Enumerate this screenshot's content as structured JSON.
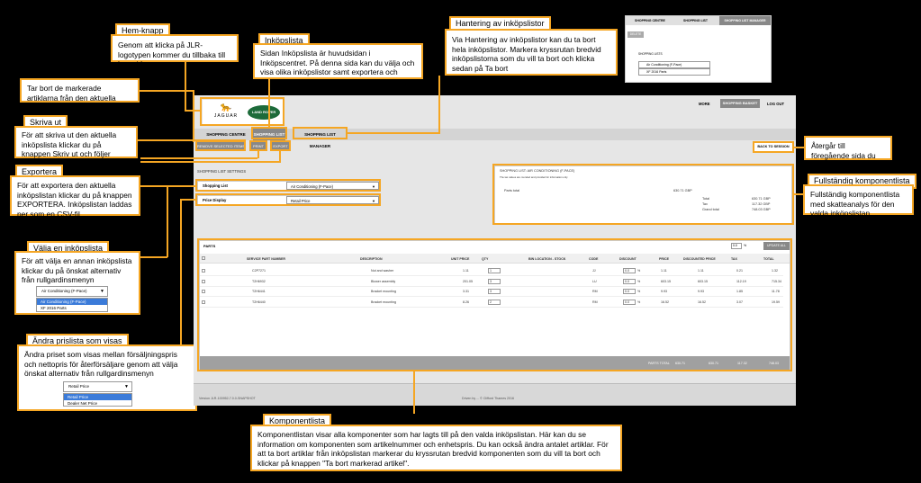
{
  "callouts": {
    "hem": {
      "title": "Hem-knapp",
      "text": "Genom att klicka på JLR-logotypen kommer du tillbaka till hemsidan"
    },
    "inkop": {
      "title": "Inköpslista",
      "text": "Sidan Inköpslista är huvudsidan i Inköpscentret. På denna sida kan du välja och visa olika inköpslistor samt exportera och skriva ut"
    },
    "hantering": {
      "title": "Hantering av inköpslistor",
      "text": "Via Hantering av inköpslistor kan du ta bort hela inköpslistor. Markera kryssrutan bredvid inköpslistorna som du vill ta bort och klicka sedan på Ta bort"
    },
    "tarbort": {
      "text": "Tar bort de markerade artiklarna från den aktuella inköpslistan"
    },
    "skriv": {
      "title": "Skriva ut",
      "text": "För att skriva ut den aktuella inköpslista klickar du på knappen Skriv ut och följer utskriftsguiden"
    },
    "export": {
      "title": "Exportera",
      "text": "För att exportera den aktuella inköpslistan klickar du på knappen EXPORTERA. Inköpslistan laddas ner som en CSV-fil"
    },
    "valja": {
      "title": "Välja en inköpslista",
      "text": "För att välja en annan inköpslista klickar du på önskat alternativ från rullgardinsmenyn"
    },
    "andra": {
      "title": "Ändra prislista som visas",
      "text": "Ändra priset som visas mellan försäljningspris och nettopris för återförsäljare genom att välja önskat alternativ från rullgardinsmenyn"
    },
    "atergar": {
      "text": "Återgår till föregående sida du besökte"
    },
    "full": {
      "title": "Fullständig komponentlista",
      "text": "Fullständig komponentlista med skatteanalys för den valda inköpslistan"
    },
    "komp": {
      "title": "Komponentlista",
      "text": "Komponentlistan visar alla komponenter som har lagts till på den valda inköpslistan. Här kan du se information om komponenten som artikelnummer och enhetspris. Du kan också ändra antalet artiklar. För att ta bort artiklar från inköpslistan markerar du kryssrutan bredvid komponenten som du vill ta bort och klickar på knappen \"Ta bort markerad artikel\"."
    }
  },
  "dropdown_examples": {
    "list_selected": "Air Conditioning (F-Pace)",
    "list_options": [
      "Air Conditioning (F-Pace)",
      "XF 2016 Parts"
    ],
    "price_selected": "Retail Price",
    "price_options": [
      "Retail Price",
      "Dealer Net Price"
    ]
  },
  "mini_manager": {
    "tabs": [
      "SHOPPING CENTRE",
      "SHOPPING LIST",
      "SHOPPING LIST MANAGER"
    ],
    "delete": "DELETE",
    "heading": "SHOPPING LISTS",
    "items": [
      "Air Conditioning (F-Pace)",
      "XF 2016 Parts"
    ]
  },
  "app": {
    "brand": {
      "jaguar": "JAGUAR",
      "landrover": "LAND ROVER"
    },
    "topnav": [
      "MORE",
      "SHOPPING BASKET",
      "LOG OUT"
    ],
    "tabs": [
      "SHOPPING CENTRE",
      "SHOPPING LIST",
      "SHOPPING LIST MANAGER"
    ],
    "actions": {
      "remove": "REMOVE SELECTED ITEMS",
      "print": "PRINT",
      "export": "EXPORT",
      "back": "BACK TO SESSION"
    },
    "settings": {
      "heading": "SHOPPING LIST SETTINGS",
      "list_label": "Shopping List",
      "list_value": "Air Conditioning (F-Pace)",
      "price_label": "Price Display",
      "price_value": "Retail Price"
    },
    "summary": {
      "title": "SHOPPING LIST: AIR CONDITIONING (F-PACE)",
      "note": "The tax values are rounded and provided for information only",
      "parts_total_label": "Parts total",
      "parts_total": "630.71 GBP",
      "total_label": "Total",
      "total": "630.71 GBP",
      "tax_label": "Tax",
      "tax": "117.32 GBP",
      "grand_label": "Grand total",
      "grand": "748.03 GBP"
    },
    "parts": {
      "title": "PARTS",
      "qty_value": "0.0",
      "pct": "%",
      "update": "UPDATE ALL",
      "headers": [
        "SERVICE PART NUMBER",
        "DESCRIPTION",
        "UNIT PRICE",
        "QTY",
        "BIN LOCATION - STOCK",
        "CODE",
        "DISCOUNT",
        "PRICE",
        "DISCOUNTED PRICE",
        "TAX",
        "TOTAL"
      ],
      "rows": [
        [
          "C2P7271",
          "Nut and washer",
          "1.11",
          "1",
          "",
          "JJ",
          "0.0",
          "1.11",
          "1.11",
          "0.21",
          "1.32"
        ],
        [
          "T2H6932",
          "Blower assembly",
          "201.05",
          "3",
          "",
          "LU",
          "0.0",
          "603.15",
          "603.15",
          "112.19",
          "715.34"
        ],
        [
          "T2H6441",
          "Bracket mounting",
          "3.31",
          "3",
          "",
          "RM",
          "0.0",
          "9.93",
          "9.93",
          "1.85",
          "11.78"
        ],
        [
          "T2H6440",
          "Bracket mounting",
          "8.26",
          "2",
          "",
          "RM",
          "0.0",
          "16.52",
          "16.52",
          "3.07",
          "19.59"
        ]
      ],
      "footer": {
        "label": "PARTS TOTAL",
        "total": "630.71",
        "price": "630.71",
        "tax": "117.32",
        "grand": "748.03"
      }
    },
    "version": "Version JLR-100952-7.0.0-SNAPSHOT",
    "copyright": "Driven by ... © Clifford Thames 2016"
  },
  "colors": {
    "accent": "#f5a623",
    "tab_active": "#888888",
    "bar": "#a0a0a0"
  }
}
